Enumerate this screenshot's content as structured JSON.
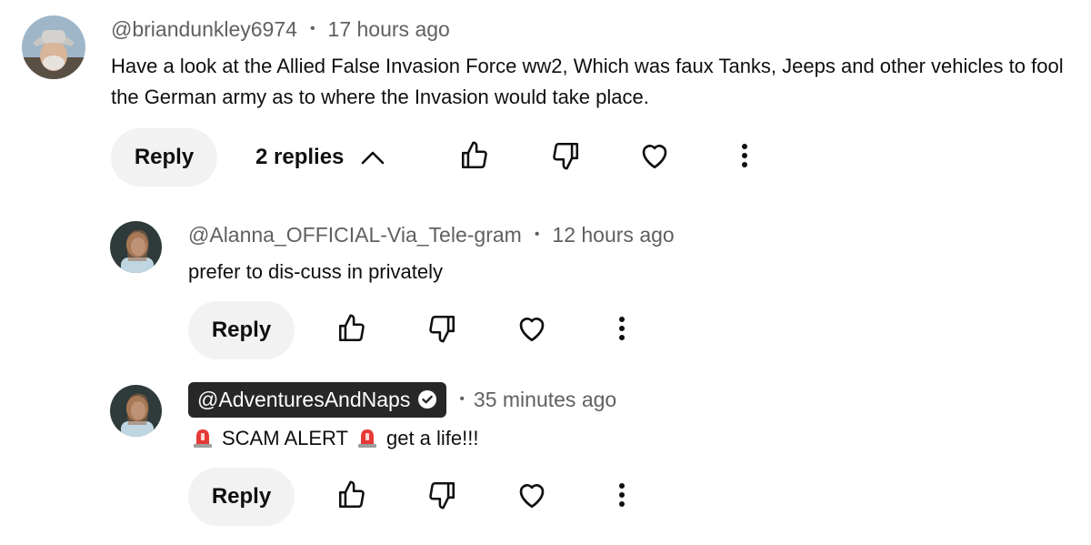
{
  "comments": [
    {
      "handle": "@briandunkley6974",
      "time": "17 hours ago",
      "text": "Have a look at the Allied False Invasion Force ww2, Which was faux Tanks, Jeeps and other vehicles to fool the German army as to where the Invasion would take place.",
      "reply_label": "Reply",
      "replies_label": "2 replies"
    },
    {
      "handle": "@Alanna_OFFICIAL-Via_Tele-gram",
      "time": "12 hours ago",
      "text": "prefer to dis-cuss in privately",
      "reply_label": "Reply"
    },
    {
      "handle": "@AdventuresAndNaps",
      "time": "35 minutes ago",
      "text_part1": "SCAM ALERT",
      "text_part2": "get a life!!!",
      "reply_label": "Reply"
    }
  ],
  "separator": "•",
  "icons": [
    "thumbs-up-icon",
    "thumbs-down-icon",
    "heart-icon",
    "more-vert-icon",
    "chevron-up-icon",
    "verified-check-icon",
    "police-light-emoji"
  ],
  "colors": {
    "pill_bg": "#f2f2f2",
    "secondary_text": "#606060",
    "handle_pill": "#272727"
  }
}
